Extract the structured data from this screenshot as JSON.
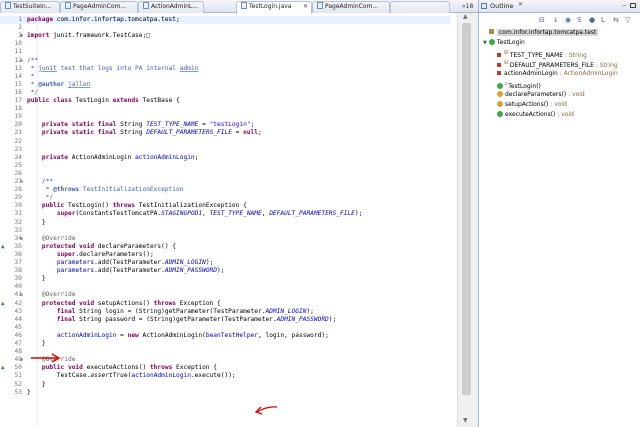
{
  "tabs": [
    {
      "label": "TestSuiteIn...",
      "active": false
    },
    {
      "label": "PageAdminCom...",
      "active": false
    },
    {
      "label": "ActionAdminL...",
      "active": false
    },
    {
      "label": "TestLogin.java",
      "active": true
    },
    {
      "label": "PageAdminCom...",
      "active": false
    }
  ],
  "tab_overflow": "»18",
  "code_lines": [
    {
      "n": "1",
      "current": true,
      "html": "<span class=\"k\">package</span> com.infor.infortap.tomcatpa.test;"
    },
    {
      "n": "2",
      "html": ""
    },
    {
      "n": "3",
      "mk": "+",
      "html": "<span class=\"k\">import</span> junit.framework.TestCase;&#9633;"
    },
    {
      "n": "10",
      "html": ""
    },
    {
      "n": "11",
      "html": ""
    },
    {
      "n": "12",
      "mk": "-",
      "html": "<span class=\"d\">/**</span>"
    },
    {
      "n": "13",
      "html": "<span class=\"d\"> * <span class=\"u\">junit</span> test that logs into PA internal <span class=\"u\">admin</span></span>"
    },
    {
      "n": "14",
      "html": "<span class=\"d\"> *</span>"
    },
    {
      "n": "15",
      "html": "<span class=\"d\"> * <b>@author</b> <span class=\"u\">jallen</span></span>"
    },
    {
      "n": "16",
      "html": "<span class=\"d\"> */</span>"
    },
    {
      "n": "17",
      "html": "<span class=\"k\">public class</span> TestLogin <span class=\"k\">extends</span> TestBase {"
    },
    {
      "n": "18",
      "html": ""
    },
    {
      "n": "19",
      "html": ""
    },
    {
      "n": "20",
      "html": "    <span class=\"k\">private static final</span> String <span class=\"fi\">TEST_TYPE_NAME</span> = <span class=\"s\">\"testLogin\"</span>;"
    },
    {
      "n": "21",
      "html": "    <span class=\"k\">private static final</span> String <span class=\"fi\">DEFAULT_PARAMETERS_FILE</span> = <span class=\"k\">null</span>;"
    },
    {
      "n": "22",
      "html": ""
    },
    {
      "n": "23",
      "html": ""
    },
    {
      "n": "24",
      "html": "    <span class=\"k\">private</span> ActionAdminLogin <span class=\"f\">actionAdminLogin</span>;"
    },
    {
      "n": "25",
      "html": ""
    },
    {
      "n": "26",
      "html": ""
    },
    {
      "n": "27",
      "mk": "-",
      "html": "    <span class=\"d\">/**</span>"
    },
    {
      "n": "28",
      "html": "<span class=\"d\">     * <b>@throws</b> TestInitializationException</span>"
    },
    {
      "n": "29",
      "html": "<span class=\"d\">     */</span>"
    },
    {
      "n": "30",
      "html": "    <span class=\"k\">public</span> TestLogin() <span class=\"k\">throws</span> TestInitializationException {"
    },
    {
      "n": "31",
      "html": "        <span class=\"k\">super</span>(ConstantsTestTomcatPA.<span class=\"fi\">STAGINGPOD1</span>, <span class=\"fi\">TEST_TYPE_NAME</span>, <span class=\"fi\">DEFAULT_PARAMETERS_FILE</span>);"
    },
    {
      "n": "32",
      "html": "    }"
    },
    {
      "n": "33",
      "html": ""
    },
    {
      "n": "34",
      "mk": "-",
      "html": "    <span class=\"an\">@Override</span>"
    },
    {
      "n": "35",
      "tri": true,
      "html": "    <span class=\"k\">protected void</span> declareParameters() {"
    },
    {
      "n": "36",
      "html": "        <span class=\"k\">super</span>.declareParameters();"
    },
    {
      "n": "37",
      "html": "        <span class=\"f\">parameters</span>.add(TestParameter.<span class=\"fi\">ADMIN_LOGIN</span>);"
    },
    {
      "n": "38",
      "html": "        <span class=\"f\">parameters</span>.add(TestParameter.<span class=\"fi\">ADMIN_PASSWORD</span>);"
    },
    {
      "n": "39",
      "html": "    }"
    },
    {
      "n": "40",
      "html": ""
    },
    {
      "n": "41",
      "mk": "-",
      "html": "    <span class=\"an\">@Override</span>"
    },
    {
      "n": "42",
      "tri": true,
      "html": "    <span class=\"k\">protected void</span> setupActions() <span class=\"k\">throws</span> Exception {"
    },
    {
      "n": "43",
      "html": "        <span class=\"k\">final</span> String login = (String)getParameter(TestParameter.<span class=\"fi\">ADMIN_LOGIN</span>);"
    },
    {
      "n": "44",
      "html": "        <span class=\"k\">final</span> String password = (String)getParameter(TestParameter.<span class=\"fi\">ADMIN_PASSWORD</span>);"
    },
    {
      "n": "45",
      "html": ""
    },
    {
      "n": "46",
      "html": "        <span class=\"f\">actionAdminLogin</span> = <span class=\"k\">new</span> ActionAdminLogin(<span class=\"f\">beanTestHelper</span>, login, password);"
    },
    {
      "n": "47",
      "html": "    }"
    },
    {
      "n": "48",
      "html": ""
    },
    {
      "n": "49",
      "mk": "-",
      "html": "    <span class=\"an\">@Override</span>"
    },
    {
      "n": "50",
      "tri": true,
      "html": "    <span class=\"k\">public void</span> executeActions() <span class=\"k\">throws</span> Exception {"
    },
    {
      "n": "51",
      "html": "        TestCase.<i>assertTrue</i>(<span class=\"f\">actionAdminLogin</span>.execute());"
    },
    {
      "n": "52",
      "html": "    }"
    },
    {
      "n": "53",
      "html": "}"
    }
  ],
  "outline": {
    "title": "Outline",
    "package": "com.infor.infortap.tomcatpa.test",
    "class_name": "TestLogin",
    "members": [
      {
        "name": "TEST_TYPE_NAME",
        "type": " : String",
        "kind": "static-final-field",
        "sup": "SF"
      },
      {
        "name": "DEFAULT_PARAMETERS_FILE",
        "type": " : String",
        "kind": "static-final-field",
        "sup": "SF"
      },
      {
        "name": "actionAdminLogin",
        "type": " : ActionAdminLogin",
        "kind": "private-field",
        "sup": ""
      },
      {
        "name": "TestLogin()",
        "type": "",
        "kind": "constructor",
        "sup": "c"
      },
      {
        "name": "declareParameters()",
        "type": " : void",
        "kind": "protected-method",
        "sup": ""
      },
      {
        "name": "setupActions()",
        "type": " : void",
        "kind": "protected-method",
        "sup": ""
      },
      {
        "name": "executeActions()",
        "type": " : void",
        "kind": "public-method",
        "sup": ""
      }
    ]
  },
  "colors": {
    "keyword": "#7f0055",
    "string": "#2a00ff",
    "field": "#0000c0",
    "javadoc": "#3f5fbf",
    "annotation_arrow": "#e00000"
  }
}
